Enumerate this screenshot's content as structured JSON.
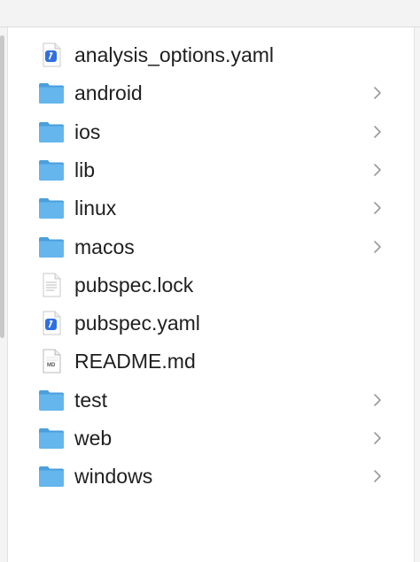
{
  "files": [
    {
      "name": "analysis_options.yaml",
      "kind": "yaml",
      "icon": "yaml-file-icon",
      "expandable": false
    },
    {
      "name": "android",
      "kind": "folder",
      "icon": "folder-icon",
      "expandable": true
    },
    {
      "name": "ios",
      "kind": "folder",
      "icon": "folder-icon",
      "expandable": true
    },
    {
      "name": "lib",
      "kind": "folder",
      "icon": "folder-icon",
      "expandable": true
    },
    {
      "name": "linux",
      "kind": "folder",
      "icon": "folder-icon",
      "expandable": true
    },
    {
      "name": "macos",
      "kind": "folder",
      "icon": "folder-icon",
      "expandable": true
    },
    {
      "name": "pubspec.lock",
      "kind": "text",
      "icon": "text-file-icon",
      "expandable": false
    },
    {
      "name": "pubspec.yaml",
      "kind": "yaml",
      "icon": "yaml-file-icon",
      "expandable": false
    },
    {
      "name": "README.md",
      "kind": "md",
      "icon": "markdown-file-icon",
      "expandable": false
    },
    {
      "name": "test",
      "kind": "folder",
      "icon": "folder-icon",
      "expandable": true
    },
    {
      "name": "web",
      "kind": "folder",
      "icon": "folder-icon",
      "expandable": true
    },
    {
      "name": "windows",
      "kind": "folder",
      "icon": "folder-icon",
      "expandable": true
    }
  ],
  "md_badge": "MD",
  "colors": {
    "folder": "#64b6ec",
    "folder_dark": "#4a9fdc",
    "yaml_badge": "#2f6fe0",
    "chevron": "#9a9a9a"
  }
}
